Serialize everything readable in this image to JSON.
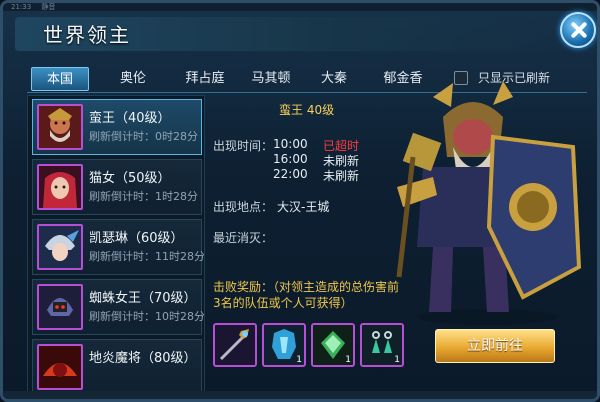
{
  "status": {
    "time": "21:33",
    "text": "静音"
  },
  "window": {
    "title": "世界领主"
  },
  "tabs": [
    {
      "label": "本国"
    },
    {
      "label": "奥伦"
    },
    {
      "label": "拜占庭"
    },
    {
      "label": "马其顿"
    },
    {
      "label": "大秦"
    },
    {
      "label": "郁金香"
    }
  ],
  "filter": {
    "label": "只显示已刷新"
  },
  "bosses": [
    {
      "name": "蛮王（40级）",
      "timer": "刷新倒计时：0时28分"
    },
    {
      "name": "猫女（50级）",
      "timer": "刷新倒计时：1时28分"
    },
    {
      "name": "凯瑟琳（60级）",
      "timer": "刷新倒计时：11时28分"
    },
    {
      "name": "蜘蛛女王（70级）",
      "timer": "刷新倒计时：10时28分"
    },
    {
      "name": "地炎魔将（80级）",
      "timer": ""
    }
  ],
  "detail": {
    "title": "蛮王  40级",
    "appear_time_label": "出现时间：",
    "times": [
      {
        "time": "10:00",
        "status": "已超时"
      },
      {
        "time": "16:00",
        "status": "未刷新"
      },
      {
        "time": "22:00",
        "status": "未刷新"
      }
    ],
    "location_label": "出现地点：",
    "location": "大汉-王城",
    "recent_label": "最近消灭：",
    "reward_label": "击败奖励：",
    "reward_desc": "（对领主造成的总伤害前3名的队伍或个人可获得）",
    "rewards": [
      {
        "icon": "staff-icon",
        "qty": ""
      },
      {
        "icon": "armor-icon",
        "qty": "1"
      },
      {
        "icon": "gem-icon",
        "qty": "1"
      },
      {
        "icon": "earring-icon",
        "qty": "1"
      }
    ],
    "go_button": "立即前往"
  },
  "colors": {
    "accent": "#3d90c4",
    "gold": "#f0c84a",
    "alert": "#ff3b3b",
    "rare_border": "#b64fd6"
  }
}
